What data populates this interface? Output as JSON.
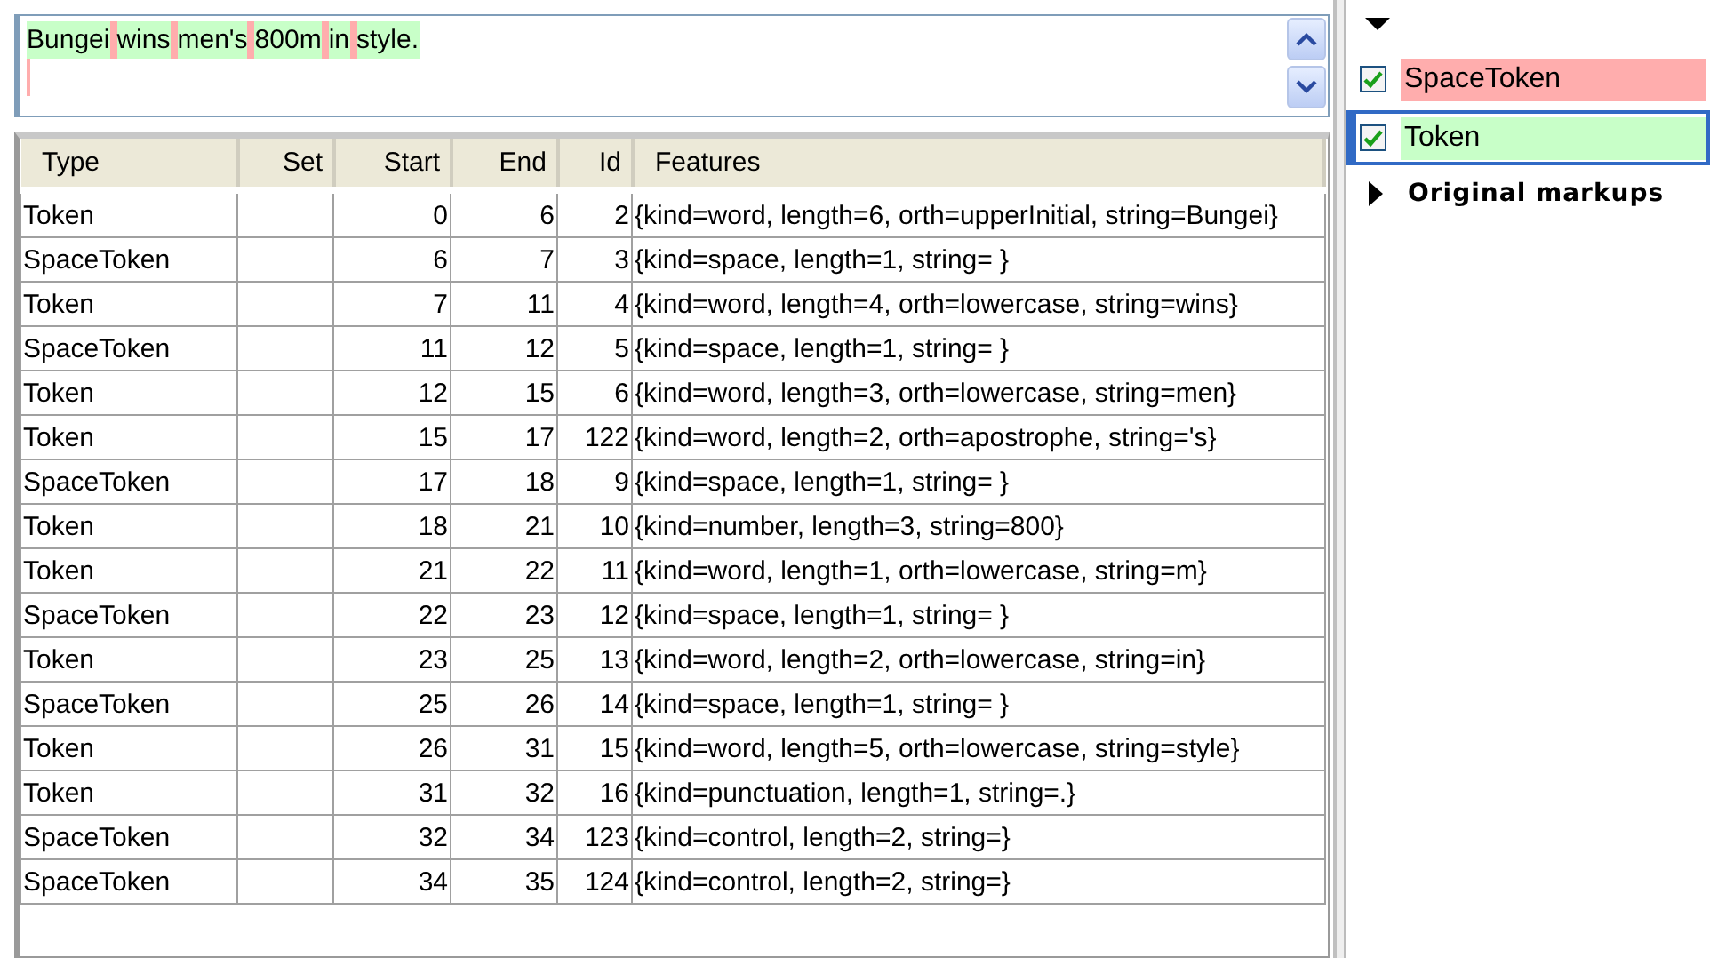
{
  "document": {
    "segments": [
      {
        "text": "Bungei",
        "kind": "token"
      },
      {
        "kind": "space"
      },
      {
        "text": "wins",
        "kind": "token"
      },
      {
        "kind": "space"
      },
      {
        "text": "men",
        "kind": "token"
      },
      {
        "text": "'s",
        "kind": "token"
      },
      {
        "kind": "space"
      },
      {
        "text": "800",
        "kind": "token"
      },
      {
        "text": "m",
        "kind": "token"
      },
      {
        "kind": "space"
      },
      {
        "text": "in",
        "kind": "token"
      },
      {
        "kind": "space"
      },
      {
        "text": "style",
        "kind": "token"
      },
      {
        "text": ".",
        "kind": "token"
      },
      {
        "kind": "control"
      }
    ]
  },
  "table": {
    "columns": [
      "Type",
      "Set",
      "Start",
      "End",
      "Id",
      "Features"
    ],
    "rows": [
      [
        "Token",
        "",
        "0",
        "6",
        "2",
        "{kind=word, length=6, orth=upperInitial, string=Bungei}"
      ],
      [
        "SpaceToken",
        "",
        "6",
        "7",
        "3",
        "{kind=space, length=1, string= }"
      ],
      [
        "Token",
        "",
        "7",
        "11",
        "4",
        "{kind=word, length=4, orth=lowercase, string=wins}"
      ],
      [
        "SpaceToken",
        "",
        "11",
        "12",
        "5",
        "{kind=space, length=1, string= }"
      ],
      [
        "Token",
        "",
        "12",
        "15",
        "6",
        "{kind=word, length=3, orth=lowercase, string=men}"
      ],
      [
        "Token",
        "",
        "15",
        "17",
        "122",
        "{kind=word, length=2, orth=apostrophe, string='s}"
      ],
      [
        "SpaceToken",
        "",
        "17",
        "18",
        "9",
        "{kind=space, length=1, string= }"
      ],
      [
        "Token",
        "",
        "18",
        "21",
        "10",
        "{kind=number, length=3, string=800}"
      ],
      [
        "Token",
        "",
        "21",
        "22",
        "11",
        "{kind=word, length=1, orth=lowercase, string=m}"
      ],
      [
        "SpaceToken",
        "",
        "22",
        "23",
        "12",
        "{kind=space, length=1, string= }"
      ],
      [
        "Token",
        "",
        "23",
        "25",
        "13",
        "{kind=word, length=2, orth=lowercase, string=in}"
      ],
      [
        "SpaceToken",
        "",
        "25",
        "26",
        "14",
        "{kind=space, length=1, string= }"
      ],
      [
        "Token",
        "",
        "26",
        "31",
        "15",
        "{kind=word, length=5, orth=lowercase, string=style}"
      ],
      [
        "Token",
        "",
        "31",
        "32",
        "16",
        "{kind=punctuation, length=1, string=.}"
      ],
      [
        "SpaceToken",
        "",
        "32",
        "34",
        "123",
        "{kind=control, length=2, string=}"
      ],
      [
        "SpaceToken",
        "",
        "34",
        "35",
        "124",
        "{kind=control, length=2, string=}"
      ]
    ]
  },
  "annotation_sets": {
    "expanded": true,
    "types": [
      {
        "label": "SpaceToken",
        "checked": true,
        "selected": false,
        "color": "#ffadad"
      },
      {
        "label": "Token",
        "checked": true,
        "selected": true,
        "color": "#c8ffc8"
      }
    ],
    "groups": [
      {
        "label": "Original markups",
        "expanded": false
      }
    ]
  }
}
